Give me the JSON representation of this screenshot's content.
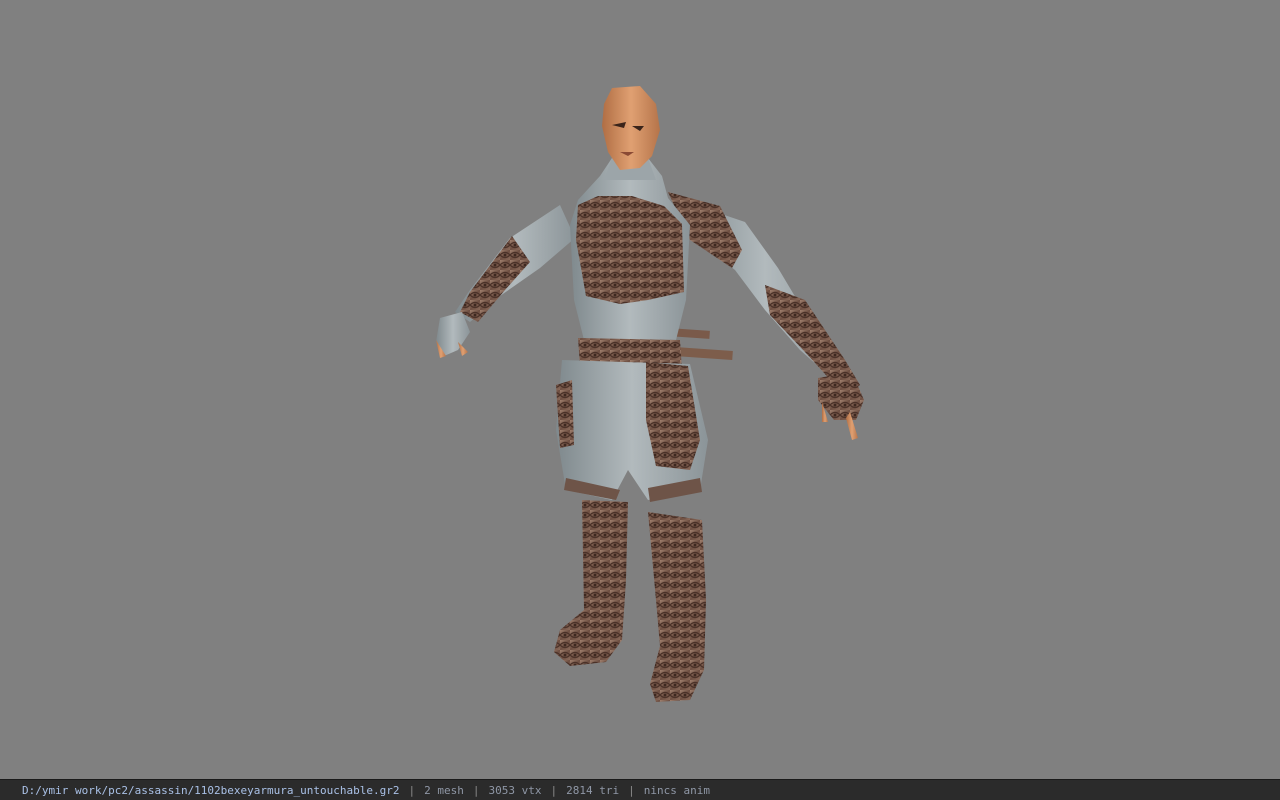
{
  "viewport": {
    "background_color": "#808080",
    "model": {
      "description_icon": "character-model-icon",
      "cloth_color": "#a3acaf",
      "armor_color": "#8a6a5a",
      "skin_color": "#d9925f"
    }
  },
  "status_bar": {
    "file_path": "D:/ymir work/pc2/assassin/1102bexeyarmura_untouchable.gr2",
    "separator": "|",
    "mesh_count": "2 mesh",
    "vertex_count": "3053 vtx",
    "triangle_count": "2814 tri",
    "animation": "nincs anim"
  }
}
